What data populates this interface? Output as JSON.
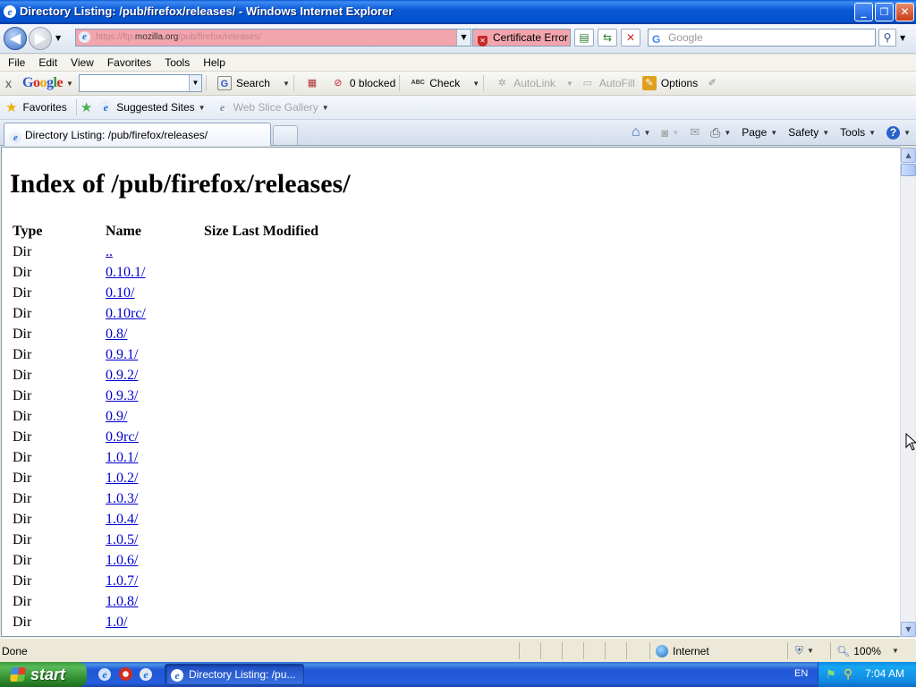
{
  "window": {
    "title": "Directory Listing: /pub/firefox/releases/ - Windows Internet Explorer",
    "minimize": "_",
    "restore": "❐",
    "close": "✕"
  },
  "address": {
    "url_prefix": "https://ftp.",
    "url_domain": "mozilla.org",
    "url_path": "/pub/firefox/releases/",
    "cert_error": "Certificate Error",
    "search_placeholder": "Google"
  },
  "menu": [
    "File",
    "Edit",
    "View",
    "Favorites",
    "Tools",
    "Help"
  ],
  "google_toolbar": {
    "close": "x",
    "search_label": "Search",
    "blocked_label": "0 blocked",
    "check_label": "Check",
    "autolink_label": "AutoLink",
    "autofill_label": "AutoFill",
    "options_label": "Options",
    "abc": "ABC"
  },
  "favorites_bar": {
    "favorites_label": "Favorites",
    "suggested_label": "Suggested Sites",
    "webslice_label": "Web Slice Gallery"
  },
  "tab": {
    "title": "Directory Listing: /pub/firefox/releases/"
  },
  "command_bar": {
    "page_label": "Page",
    "safety_label": "Safety",
    "tools_label": "Tools",
    "help": "?"
  },
  "page": {
    "heading": "Index of /pub/firefox/releases/",
    "columns": [
      "Type",
      "Name",
      "Size",
      "Last Modified"
    ],
    "rows": [
      {
        "type": "Dir",
        "name": ".."
      },
      {
        "type": "Dir",
        "name": "0.10.1/"
      },
      {
        "type": "Dir",
        "name": "0.10/"
      },
      {
        "type": "Dir",
        "name": "0.10rc/"
      },
      {
        "type": "Dir",
        "name": "0.8/"
      },
      {
        "type": "Dir",
        "name": "0.9.1/"
      },
      {
        "type": "Dir",
        "name": "0.9.2/"
      },
      {
        "type": "Dir",
        "name": "0.9.3/"
      },
      {
        "type": "Dir",
        "name": "0.9/"
      },
      {
        "type": "Dir",
        "name": "0.9rc/"
      },
      {
        "type": "Dir",
        "name": "1.0.1/"
      },
      {
        "type": "Dir",
        "name": "1.0.2/"
      },
      {
        "type": "Dir",
        "name": "1.0.3/"
      },
      {
        "type": "Dir",
        "name": "1.0.4/"
      },
      {
        "type": "Dir",
        "name": "1.0.5/"
      },
      {
        "type": "Dir",
        "name": "1.0.6/"
      },
      {
        "type": "Dir",
        "name": "1.0.7/"
      },
      {
        "type": "Dir",
        "name": "1.0.8/"
      },
      {
        "type": "Dir",
        "name": "1.0/"
      }
    ]
  },
  "status": {
    "text": "Done",
    "zone": "Internet",
    "zoom": "100%"
  },
  "taskbar": {
    "start": "start",
    "window": "Directory Listing: /pu...",
    "lang": "EN",
    "clock": "7:04 AM"
  }
}
